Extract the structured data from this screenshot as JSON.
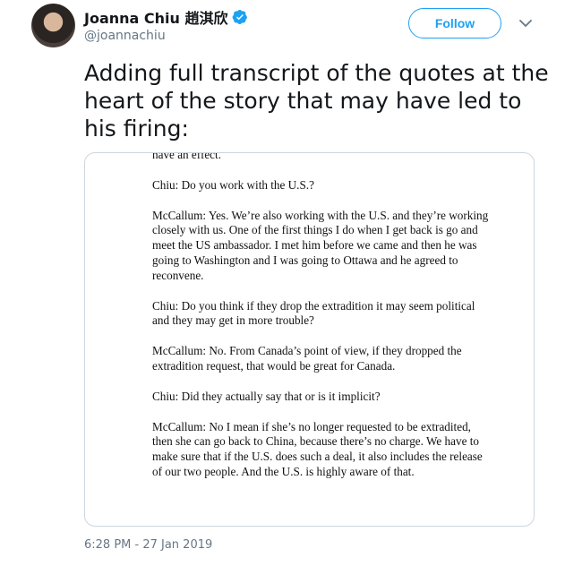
{
  "author": {
    "display_name": "Joanna Chiu 趙淇欣",
    "handle": "@joannachiu"
  },
  "follow_label": "Follow",
  "tweet_text": "Adding full transcript of the quotes at the heart of the story that may have led to his firing:",
  "transcript": [
    "have an effect.",
    "Chiu: Do you work with the U.S.?",
    "McCallum: Yes. We’re also working with the U.S. and they’re working closely with us. One of the first things I do when I get back is go and meet the US ambassador. I met him before we came and then he was going to Washington and I was going to Ottawa and he agreed to reconvene.",
    "Chiu: Do you think if they drop the extradition it may seem political and they may get in more trouble?",
    "McCallum: No. From Canada’s point of view, if they dropped the extradition request, that would be great for Canada.",
    "Chiu: Did they actually say that or is it implicit?",
    "McCallum: No I mean if she’s no longer requested to be extradited, then she can go back to China, because there’s no charge. We have to make sure that if the U.S. does such a deal, it also includes the release of our two people. And the U.S. is highly aware of that."
  ],
  "timestamp": "6:28 PM - 27 Jan 2019",
  "colors": {
    "accent": "#1da1f2",
    "muted": "#657786",
    "border": "#ccd6dd"
  },
  "icons": [
    "verified-badge-icon",
    "chevron-down-icon"
  ]
}
